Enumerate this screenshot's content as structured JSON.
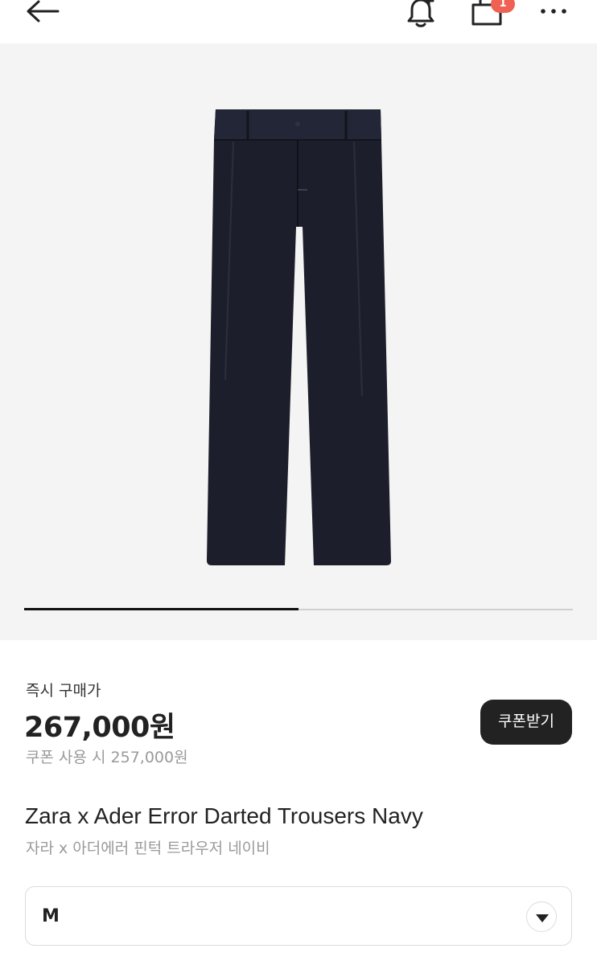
{
  "header": {
    "icons": [
      "back-arrow-icon",
      "bell-plus-icon",
      "shopping-bag-icon",
      "more-icon"
    ],
    "cart_badge": "1",
    "badge_color": "#ef6253"
  },
  "gallery": {
    "product_image": "navy-trousers-photo",
    "page_indicator": {
      "current": 1,
      "total": 2
    }
  },
  "pricing": {
    "instant_buy_label": "즉시 구매가",
    "price": "267,000원",
    "coupon_price": "쿠폰 사용 시 257,000원",
    "coupon_button": "쿠폰받기"
  },
  "product": {
    "title_en": "Zara x Ader Error Darted Trousers Navy",
    "title_ko": "자라 x 아더에러 핀턱 트라우저 네이비"
  },
  "size_select": {
    "selected": "M"
  }
}
